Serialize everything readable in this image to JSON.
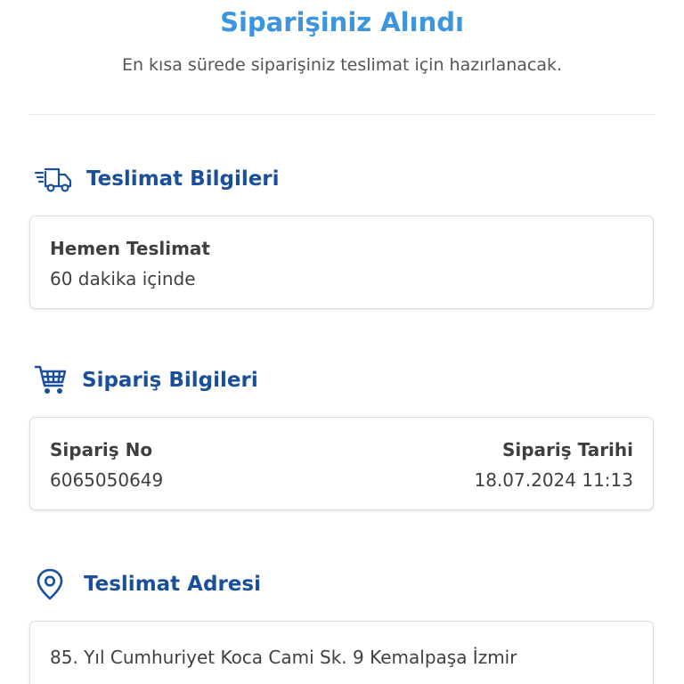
{
  "header": {
    "title": "Siparişiniz Alındı",
    "subtitle": "En kısa sürede siparişiniz teslimat için hazırlanacak."
  },
  "delivery_info": {
    "section_title": "Teslimat Bilgileri",
    "icon": "delivery-truck-icon",
    "type_label": "Hemen Teslimat",
    "time_value": "60 dakika içinde"
  },
  "order_info": {
    "section_title": "Sipariş Bilgileri",
    "icon": "shopping-cart-icon",
    "order_no_label": "Sipariş No",
    "order_no_value": "6065050649",
    "order_date_label": "Sipariş Tarihi",
    "order_date_value": "18.07.2024 11:13"
  },
  "address_info": {
    "section_title": "Teslimat Adresi",
    "icon": "location-pin-icon",
    "address": "85. Yıl Cumhuriyet Koca Cami Sk. 9 Kemalpaşa İzmir"
  },
  "colors": {
    "title": "#3d95dd",
    "section_title": "#1a4f9c",
    "text": "#3f3f3f",
    "card_border": "#dcdcdc"
  }
}
